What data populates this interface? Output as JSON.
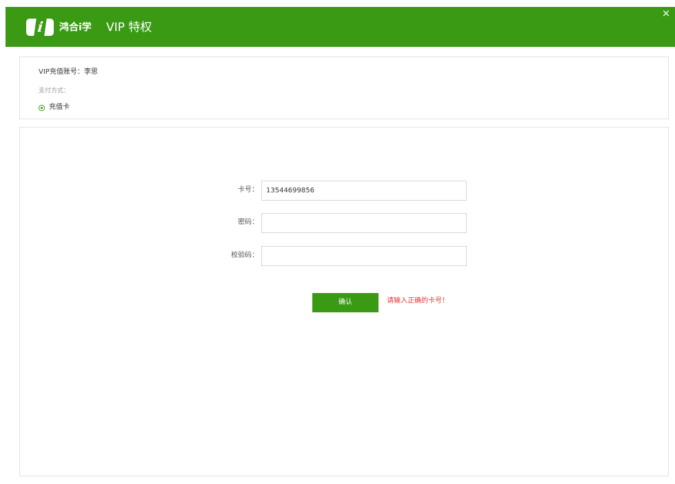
{
  "header": {
    "logo_letter": "i",
    "brand": "鸿合i学",
    "title": "VIP 特权",
    "close": "×"
  },
  "account": {
    "label": "VIP充值账号：",
    "name": "李思"
  },
  "payment": {
    "method_label": "支付方式：",
    "option_label": "充值卡"
  },
  "form": {
    "card_label": "卡号：",
    "card_value": "13544699856",
    "password_label": "密码：",
    "password_value": "",
    "captcha_label": "校验码：",
    "captcha_value": "",
    "confirm_label": "确认",
    "error_message": "请输入正确的卡号！"
  },
  "colors": {
    "brand_green": "#3a9a14",
    "error_red": "#e8363b"
  }
}
